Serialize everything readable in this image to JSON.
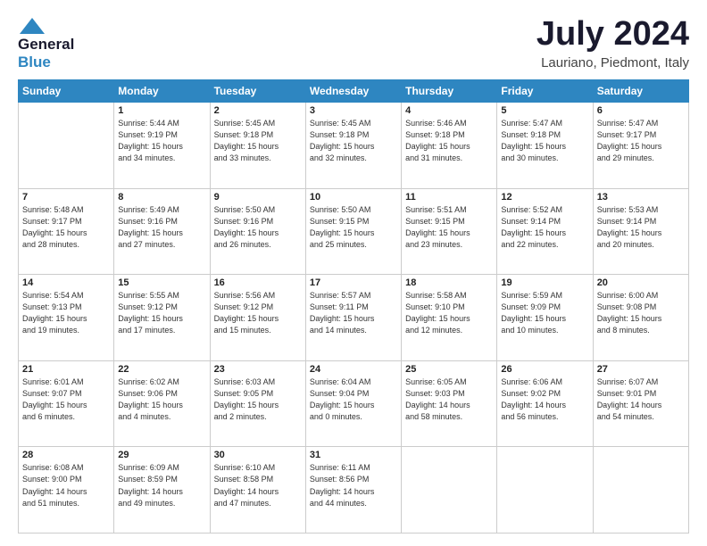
{
  "header": {
    "logo_general": "General",
    "logo_blue": "Blue",
    "month_title": "July 2024",
    "subtitle": "Lauriano, Piedmont, Italy"
  },
  "days_of_week": [
    "Sunday",
    "Monday",
    "Tuesday",
    "Wednesday",
    "Thursday",
    "Friday",
    "Saturday"
  ],
  "weeks": [
    [
      {
        "num": "",
        "text": ""
      },
      {
        "num": "1",
        "text": "Sunrise: 5:44 AM\nSunset: 9:19 PM\nDaylight: 15 hours\nand 34 minutes."
      },
      {
        "num": "2",
        "text": "Sunrise: 5:45 AM\nSunset: 9:18 PM\nDaylight: 15 hours\nand 33 minutes."
      },
      {
        "num": "3",
        "text": "Sunrise: 5:45 AM\nSunset: 9:18 PM\nDaylight: 15 hours\nand 32 minutes."
      },
      {
        "num": "4",
        "text": "Sunrise: 5:46 AM\nSunset: 9:18 PM\nDaylight: 15 hours\nand 31 minutes."
      },
      {
        "num": "5",
        "text": "Sunrise: 5:47 AM\nSunset: 9:18 PM\nDaylight: 15 hours\nand 30 minutes."
      },
      {
        "num": "6",
        "text": "Sunrise: 5:47 AM\nSunset: 9:17 PM\nDaylight: 15 hours\nand 29 minutes."
      }
    ],
    [
      {
        "num": "7",
        "text": "Sunrise: 5:48 AM\nSunset: 9:17 PM\nDaylight: 15 hours\nand 28 minutes."
      },
      {
        "num": "8",
        "text": "Sunrise: 5:49 AM\nSunset: 9:16 PM\nDaylight: 15 hours\nand 27 minutes."
      },
      {
        "num": "9",
        "text": "Sunrise: 5:50 AM\nSunset: 9:16 PM\nDaylight: 15 hours\nand 26 minutes."
      },
      {
        "num": "10",
        "text": "Sunrise: 5:50 AM\nSunset: 9:15 PM\nDaylight: 15 hours\nand 25 minutes."
      },
      {
        "num": "11",
        "text": "Sunrise: 5:51 AM\nSunset: 9:15 PM\nDaylight: 15 hours\nand 23 minutes."
      },
      {
        "num": "12",
        "text": "Sunrise: 5:52 AM\nSunset: 9:14 PM\nDaylight: 15 hours\nand 22 minutes."
      },
      {
        "num": "13",
        "text": "Sunrise: 5:53 AM\nSunset: 9:14 PM\nDaylight: 15 hours\nand 20 minutes."
      }
    ],
    [
      {
        "num": "14",
        "text": "Sunrise: 5:54 AM\nSunset: 9:13 PM\nDaylight: 15 hours\nand 19 minutes."
      },
      {
        "num": "15",
        "text": "Sunrise: 5:55 AM\nSunset: 9:12 PM\nDaylight: 15 hours\nand 17 minutes."
      },
      {
        "num": "16",
        "text": "Sunrise: 5:56 AM\nSunset: 9:12 PM\nDaylight: 15 hours\nand 15 minutes."
      },
      {
        "num": "17",
        "text": "Sunrise: 5:57 AM\nSunset: 9:11 PM\nDaylight: 15 hours\nand 14 minutes."
      },
      {
        "num": "18",
        "text": "Sunrise: 5:58 AM\nSunset: 9:10 PM\nDaylight: 15 hours\nand 12 minutes."
      },
      {
        "num": "19",
        "text": "Sunrise: 5:59 AM\nSunset: 9:09 PM\nDaylight: 15 hours\nand 10 minutes."
      },
      {
        "num": "20",
        "text": "Sunrise: 6:00 AM\nSunset: 9:08 PM\nDaylight: 15 hours\nand 8 minutes."
      }
    ],
    [
      {
        "num": "21",
        "text": "Sunrise: 6:01 AM\nSunset: 9:07 PM\nDaylight: 15 hours\nand 6 minutes."
      },
      {
        "num": "22",
        "text": "Sunrise: 6:02 AM\nSunset: 9:06 PM\nDaylight: 15 hours\nand 4 minutes."
      },
      {
        "num": "23",
        "text": "Sunrise: 6:03 AM\nSunset: 9:05 PM\nDaylight: 15 hours\nand 2 minutes."
      },
      {
        "num": "24",
        "text": "Sunrise: 6:04 AM\nSunset: 9:04 PM\nDaylight: 15 hours\nand 0 minutes."
      },
      {
        "num": "25",
        "text": "Sunrise: 6:05 AM\nSunset: 9:03 PM\nDaylight: 14 hours\nand 58 minutes."
      },
      {
        "num": "26",
        "text": "Sunrise: 6:06 AM\nSunset: 9:02 PM\nDaylight: 14 hours\nand 56 minutes."
      },
      {
        "num": "27",
        "text": "Sunrise: 6:07 AM\nSunset: 9:01 PM\nDaylight: 14 hours\nand 54 minutes."
      }
    ],
    [
      {
        "num": "28",
        "text": "Sunrise: 6:08 AM\nSunset: 9:00 PM\nDaylight: 14 hours\nand 51 minutes."
      },
      {
        "num": "29",
        "text": "Sunrise: 6:09 AM\nSunset: 8:59 PM\nDaylight: 14 hours\nand 49 minutes."
      },
      {
        "num": "30",
        "text": "Sunrise: 6:10 AM\nSunset: 8:58 PM\nDaylight: 14 hours\nand 47 minutes."
      },
      {
        "num": "31",
        "text": "Sunrise: 6:11 AM\nSunset: 8:56 PM\nDaylight: 14 hours\nand 44 minutes."
      },
      {
        "num": "",
        "text": ""
      },
      {
        "num": "",
        "text": ""
      },
      {
        "num": "",
        "text": ""
      }
    ]
  ]
}
